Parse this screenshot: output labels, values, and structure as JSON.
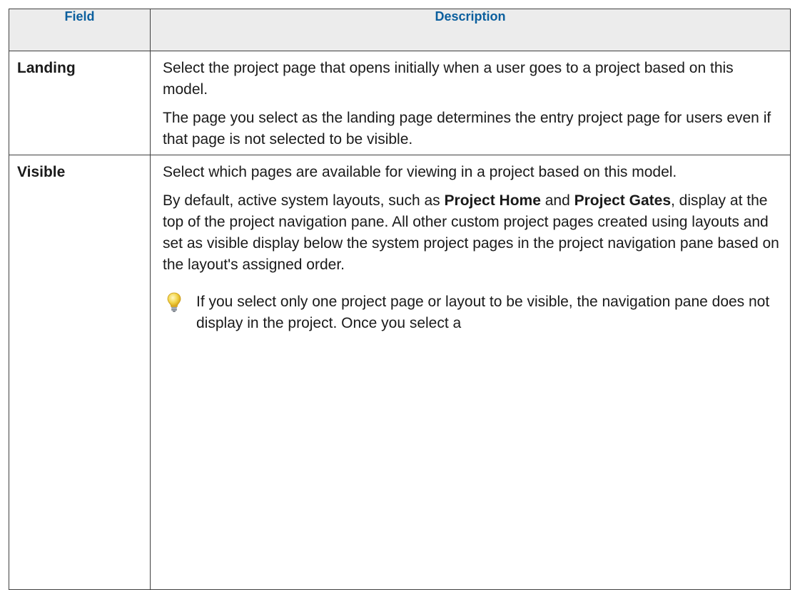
{
  "table": {
    "headers": {
      "field": "Field",
      "description": "Description"
    },
    "rows": [
      {
        "field": "Landing",
        "paragraphs": [
          "Select the project page that opens initially when a user goes to a project based on this model.",
          "The page you select as the landing page determines the entry project page for users even if that page is not selected to be visible."
        ]
      },
      {
        "field": "Visible",
        "paragraph1": "Select which pages are available for viewing in a project based on this model.",
        "paragraph2": {
          "part1": "By default, active system layouts, such as ",
          "bold1": "Project Home",
          "part2": " and ",
          "bold2": "Project Gates",
          "part3": ", display at the top of the project navigation pane. All other custom project pages created using layouts and set as visible display below the system project pages in the project navigation pane based on the layout's assigned order."
        },
        "tip": {
          "icon": "lightbulb-icon",
          "text": "If you select only one project page or layout to be visible, the navigation pane does not display in the project. Once you select a"
        }
      }
    ]
  },
  "colors": {
    "header_text": "#0b5f9e",
    "header_bg": "#ececec",
    "border": "#404040",
    "bulb": "#f2d54a"
  }
}
